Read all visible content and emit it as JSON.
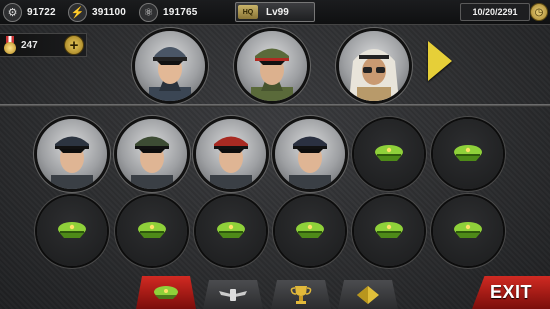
{
  "resources": {
    "gear": {
      "icon": "gear-icon",
      "value": "91722"
    },
    "energy": {
      "icon": "lightning-icon",
      "value": "391100"
    },
    "atom": {
      "icon": "atom-icon",
      "value": "191765"
    }
  },
  "headquarters": {
    "badge": "HQ",
    "level": "Lv99"
  },
  "date": "10/20/2291",
  "medals": {
    "value": "247"
  },
  "top_generals": [
    {
      "uniform": "grey",
      "cap": "#4a5666"
    },
    {
      "uniform": "olive",
      "cap": "#5a6a3a"
    },
    {
      "uniform": "desert",
      "cap": "#e8e4da"
    }
  ],
  "roster": [
    {
      "filled": true,
      "cap": "#2c3440"
    },
    {
      "filled": true,
      "cap": "#3d4c34"
    },
    {
      "filled": true,
      "cap": "#a82a22"
    },
    {
      "filled": true,
      "cap": "#2a3040"
    },
    {
      "filled": false
    },
    {
      "filled": false
    },
    {
      "filled": false
    },
    {
      "filled": false
    },
    {
      "filled": false
    },
    {
      "filled": false
    },
    {
      "filled": false
    },
    {
      "filled": false
    }
  ],
  "tabs": [
    {
      "name": "generals",
      "icon": "officer-cap-icon"
    },
    {
      "name": "skills",
      "icon": "wings-badge-icon"
    },
    {
      "name": "rewards",
      "icon": "trophy-icon"
    },
    {
      "name": "upgrade",
      "icon": "diamond-icon"
    }
  ],
  "exit_label": "EXIT",
  "colors": {
    "accent": "#e6cf38",
    "tab_active": "#c8241d",
    "cap_green": "#8fd13a"
  }
}
